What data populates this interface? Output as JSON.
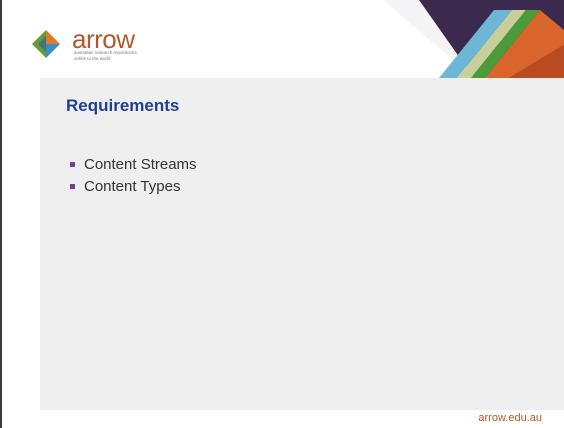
{
  "logo": {
    "word": "arrow",
    "tagline": "australian research repositories online to the world"
  },
  "slide": {
    "title": "Requirements",
    "bullets": [
      "Content Streams",
      "Content Types"
    ]
  },
  "footer": {
    "url": "arrow.edu.au"
  },
  "colors": {
    "title": "#1f3f8f",
    "bullet": "#7a3d94",
    "brand": "#b05a2c",
    "panel": "#efefef"
  }
}
